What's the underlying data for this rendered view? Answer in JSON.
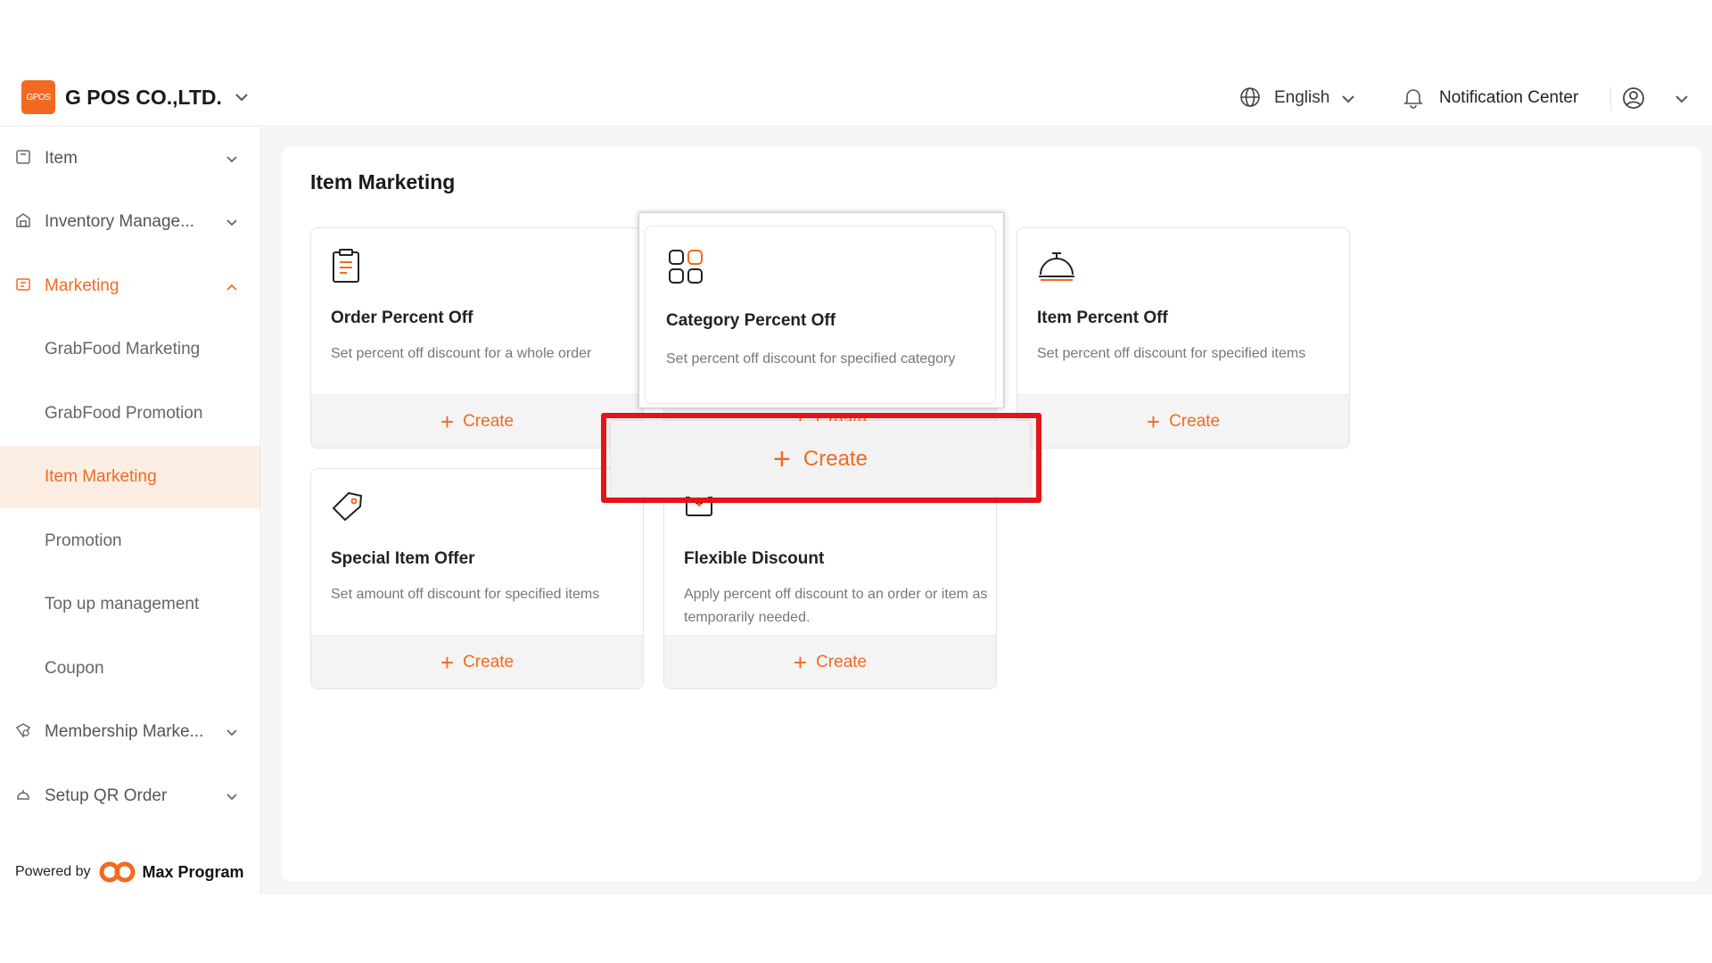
{
  "header": {
    "logo_text": "GPOS",
    "company": "G POS CO.,LTD.",
    "language": "English",
    "notification": "Notification Center"
  },
  "sidebar": {
    "items": [
      {
        "label": "Item"
      },
      {
        "label": "Inventory Manage..."
      },
      {
        "label": "Marketing"
      },
      {
        "label": "GrabFood Marketing"
      },
      {
        "label": "GrabFood Promotion"
      },
      {
        "label": "Item Marketing"
      },
      {
        "label": "Promotion"
      },
      {
        "label": "Top up management"
      },
      {
        "label": "Coupon"
      },
      {
        "label": "Membership Marke..."
      },
      {
        "label": "Setup QR Order"
      }
    ],
    "powered_by": "Powered by",
    "brand": "Max Program"
  },
  "main": {
    "title": "Item Marketing",
    "create_label": "Create",
    "cards": [
      {
        "title": "Order Percent Off",
        "desc": "Set percent off discount for a whole order"
      },
      {
        "title": "Category Percent Off",
        "desc": "Set percent off discount for specified category"
      },
      {
        "title": "Item Percent Off",
        "desc": "Set percent off discount for specified items"
      },
      {
        "title": "Special Item Offer",
        "desc": "Set amount off discount for specified items"
      },
      {
        "title": "Flexible Discount",
        "desc": "Apply percent off discount to an order or item as temporarily needed."
      }
    ]
  },
  "colors": {
    "accent": "#f26a21",
    "highlight": "#e3151a"
  }
}
